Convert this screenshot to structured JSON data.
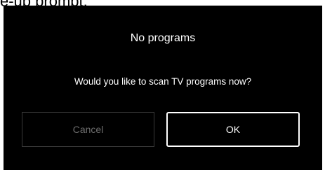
{
  "caption_fragment": "e-up prompt.",
  "dialog": {
    "title": "No programs",
    "message": "Would you like to scan TV programs now?",
    "cancel_label": "Cancel",
    "ok_label": "OK",
    "focused_button": "ok"
  },
  "colors": {
    "dialog_background": "#000000",
    "text_primary": "#ffffff",
    "text_disabled": "#6e6e6e",
    "focus_border": "#ffffff",
    "unfocused_border": "#3a3a3a"
  }
}
